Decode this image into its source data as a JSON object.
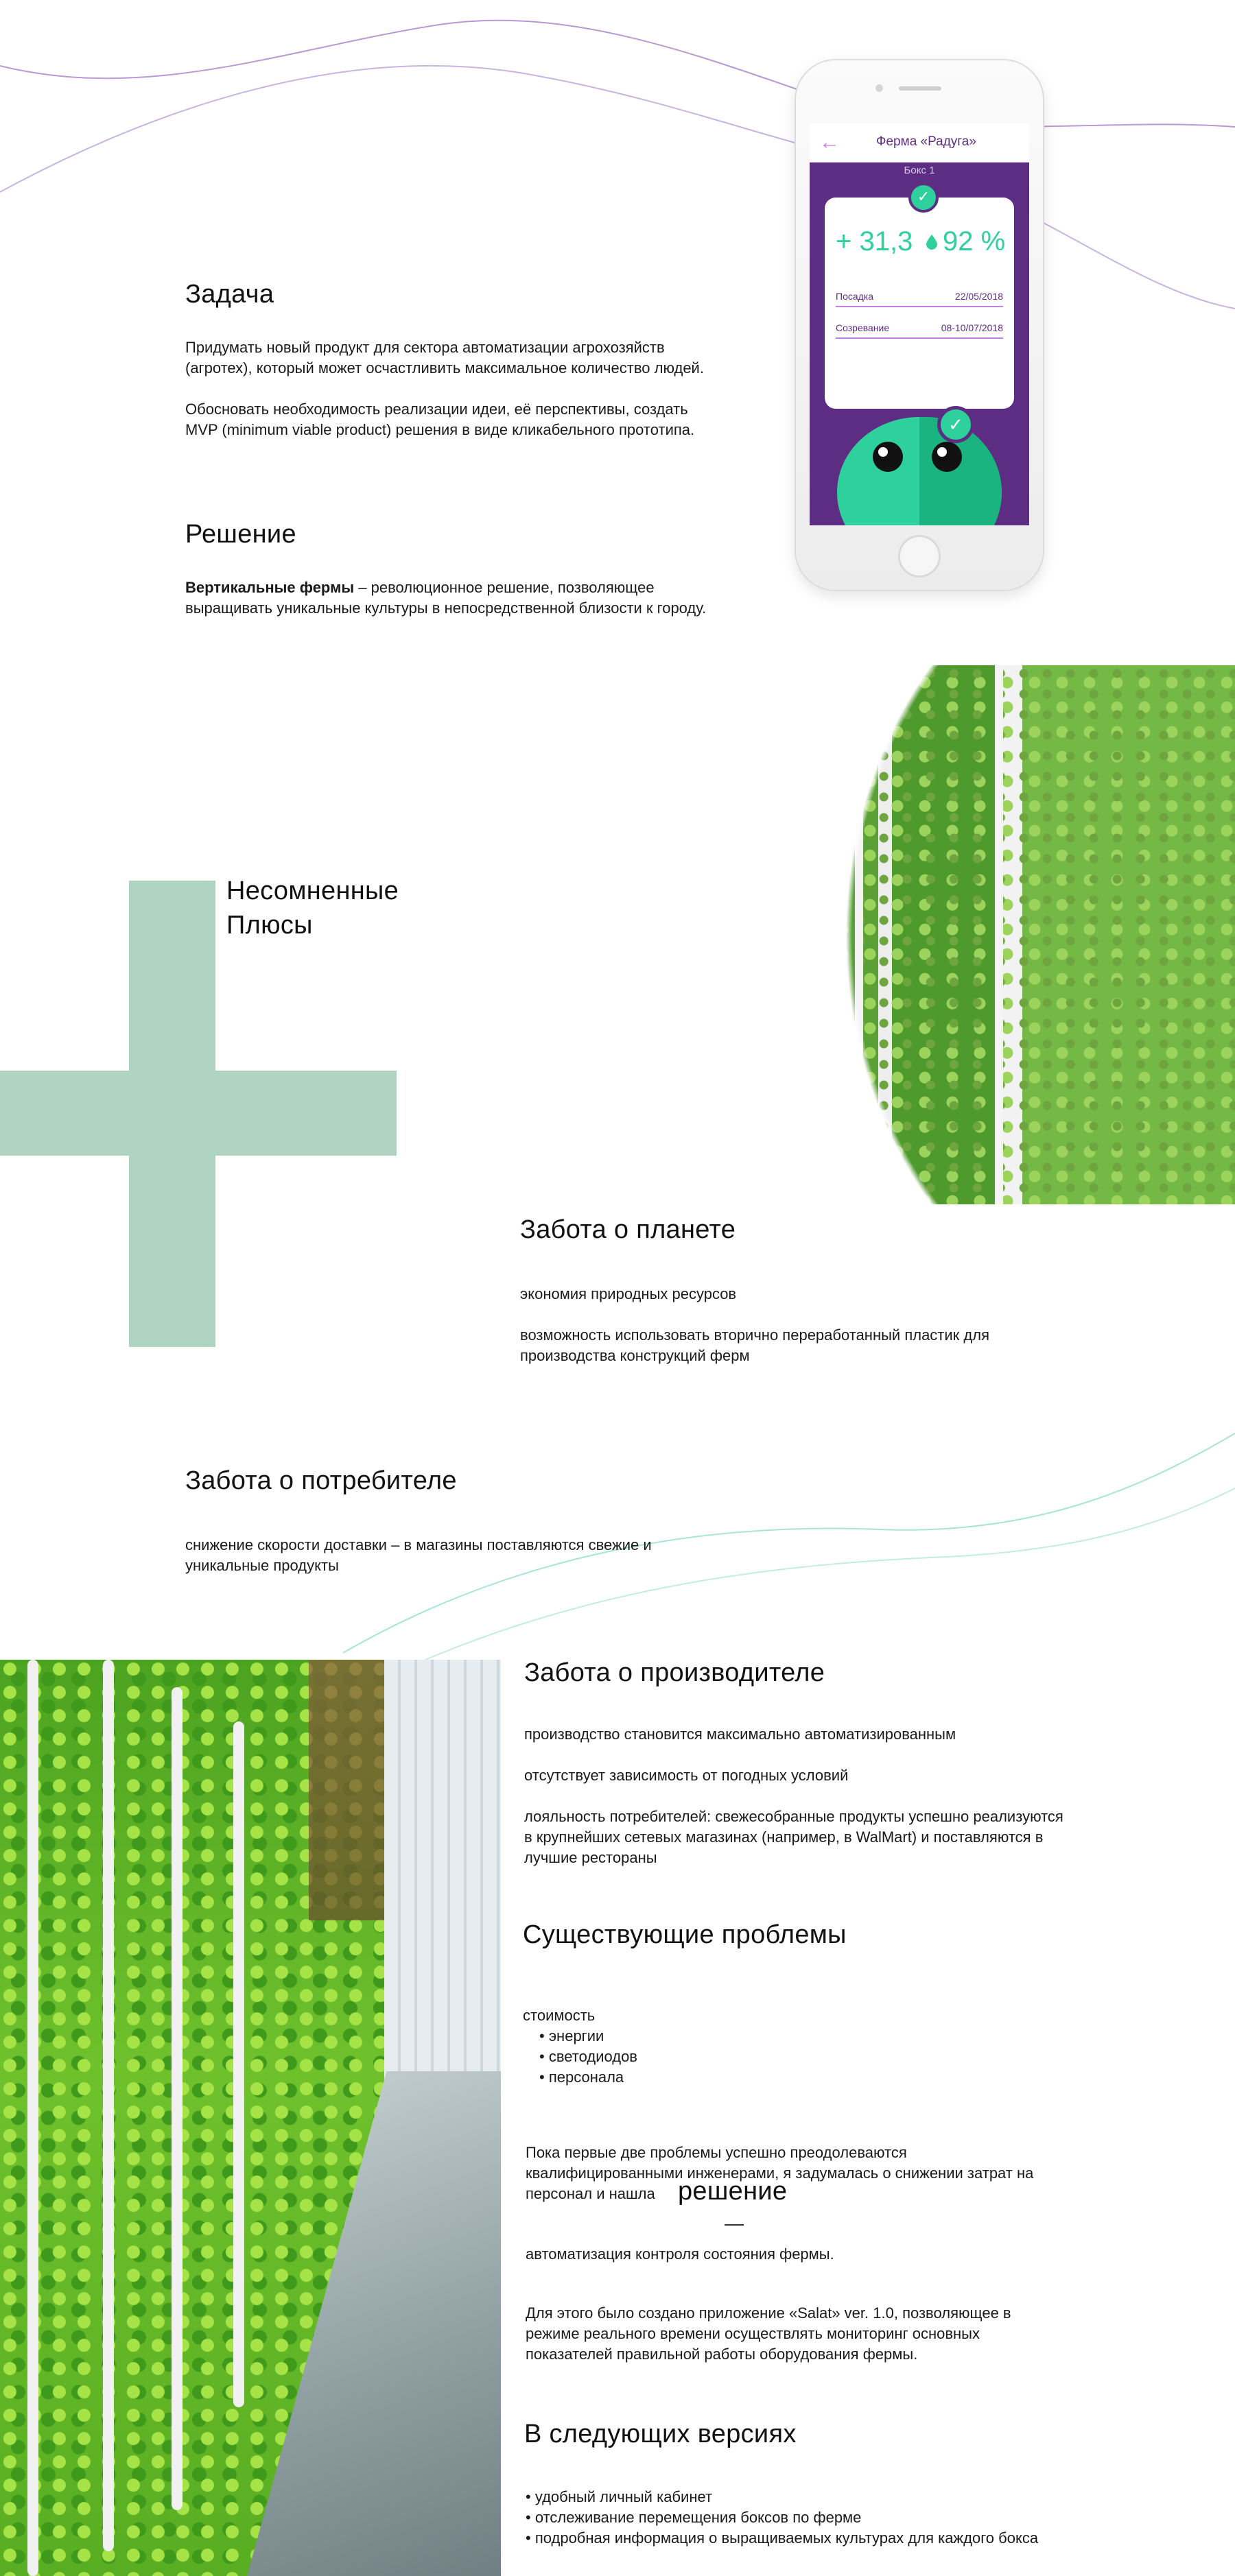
{
  "phone": {
    "app_title": "Ферма «Радуга»",
    "box_label": "Бокс 1",
    "temperature": "+ 31,3",
    "humidity": "92 %",
    "planting_label": "Посадка",
    "planting_date": "22/05/2018",
    "ripening_label": "Созревание",
    "ripening_date": "08-10/07/2018"
  },
  "task": {
    "title": "Задача",
    "p1": "Придумать новый продукт для сектора автоматизации агрохозяйств (агротех), который может осчастливить максимальное количество людей.",
    "p2": "Обосновать необходимость реализации идеи, её перспективы, создать MVP (minimum viable product) решения в виде кликабельного прототипа."
  },
  "solution": {
    "title": "Решение",
    "bold": "Вертикальные фермы",
    "rest": " – революционное решение, позволяющее выращивать уникальные культуры в непосредственной близости к городу."
  },
  "pluses": {
    "title_line1": "Несомненные",
    "title_line2": "Плюсы"
  },
  "planet": {
    "title": "Забота о планете",
    "items": [
      "экономия природных ресурсов",
      "возможность использовать вторично переработанный пластик для производства конструкций ферм"
    ]
  },
  "consumer": {
    "title": "Забота о потребителе",
    "text": "снижение скорости доставки – в магазины поставляются свежие и уникальные продукты"
  },
  "producer": {
    "title": "Забота о производителе",
    "items": [
      "производство становится максимально автоматизированным",
      "отсутствует зависимость от погодных условий",
      "лояльность потребителей: свежесобранные продукты успешно реализуются в крупнейших сетевых магазинах (например, в WalMart) и поставляются в лучшие рестораны"
    ]
  },
  "problems": {
    "title": "Существующие проблемы",
    "cost_label": "стоимость",
    "cost_items": [
      "энергии",
      "светодиодов",
      "персонала"
    ],
    "p1": "Пока первые две проблемы успешно преодолеваются квалифицированными инженерами, я задумалась о снижении затрат на персонал и нашла",
    "solution_word": "решение",
    "dash": "—",
    "p2": "автоматизация контроля состояния фермы.",
    "p3": "Для этого было создано приложение «Salat» ver. 1.0, позволяющее в режиме реального времени осуществлять мониторинг основных показателей правильной работы оборудования фермы."
  },
  "next": {
    "title": "В следующих версиях",
    "items": [
      "удобный личный кабинет",
      "отслеживание перемещения боксов по ферме",
      "подробная информация о выращиваемых культурах для каждого бокса"
    ]
  },
  "colors": {
    "accent_purple": "#5c2d82",
    "accent_green": "#2ed19b",
    "plus_green": "#b0d4c2",
    "line_purple": "#b79ad3",
    "line_green": "#a8e6cf"
  }
}
